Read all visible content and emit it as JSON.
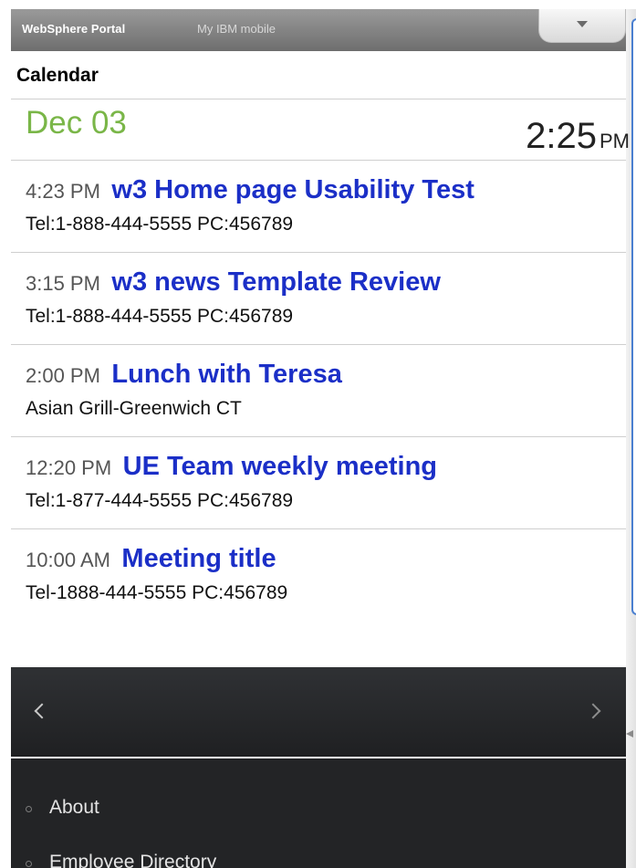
{
  "topbar": {
    "brand": "WebSphere Portal",
    "mobile_link": "My IBM mobile",
    "menu_icon": "chevron-down-icon"
  },
  "calendar": {
    "title": "Calendar",
    "date": "Dec 03",
    "time": "2:25",
    "ampm": "PM"
  },
  "events": [
    {
      "time": "4:23 PM",
      "title": "w3 Home page Usability Test",
      "detail": "Tel:1-888-444-5555 PC:456789"
    },
    {
      "time": "3:15 PM",
      "title": "w3 news Template Review",
      "detail": "Tel:1-888-444-5555 PC:456789"
    },
    {
      "time": "2:00 PM",
      "title": "Lunch with Teresa",
      "detail": "Asian Grill-Greenwich CT"
    },
    {
      "time": "12:20 PM",
      "title": "UE Team weekly meeting",
      "detail": "Tel:1-877-444-5555 PC:456789"
    },
    {
      "time": "10:00 AM",
      "title": "Meeting title",
      "detail": "Tel-1888-444-5555 PC:456789"
    }
  ],
  "nav": {
    "prev_icon": "chevron-left-icon",
    "next_icon": "chevron-right-icon"
  },
  "menu": {
    "items": [
      {
        "label": "About"
      },
      {
        "label": "Employee Directory"
      }
    ]
  },
  "colors": {
    "date_green": "#7ab648",
    "event_title_blue": "#1b2fc7",
    "nav_dark": "#232426"
  }
}
